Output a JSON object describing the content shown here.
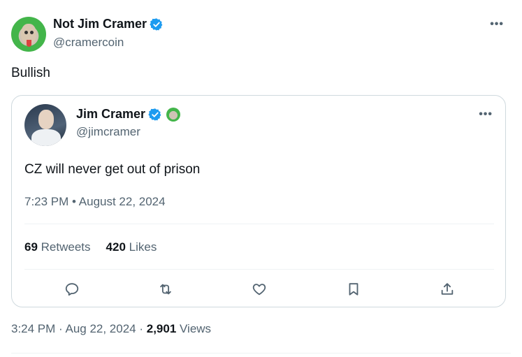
{
  "tweet": {
    "author": {
      "name": "Not Jim Cramer",
      "handle": "@cramercoin",
      "verified": true
    },
    "text": "Bullish",
    "quoted": {
      "author": {
        "name": "Jim Cramer",
        "handle": "@jimcramer",
        "verified": true
      },
      "text": "CZ will never get out of prison",
      "timestamp": "7:23 PM • August 22, 2024",
      "stats": {
        "retweets_count": "69",
        "retweets_label": "Retweets",
        "likes_count": "420",
        "likes_label": "Likes"
      }
    },
    "footer": {
      "timestamp": "3:24 PM · Aug 22, 2024 · ",
      "views_count": "2,901",
      "views_label": " Views"
    }
  },
  "colors": {
    "verified_blue": "#1d9bf0",
    "secondary_text": "#536471",
    "border": "#cfd9de"
  },
  "icons": {
    "more": "more-horizontal-icon",
    "reply": "reply-icon",
    "retweet": "retweet-icon",
    "like": "heart-icon",
    "bookmark": "bookmark-icon",
    "share": "share-icon"
  }
}
